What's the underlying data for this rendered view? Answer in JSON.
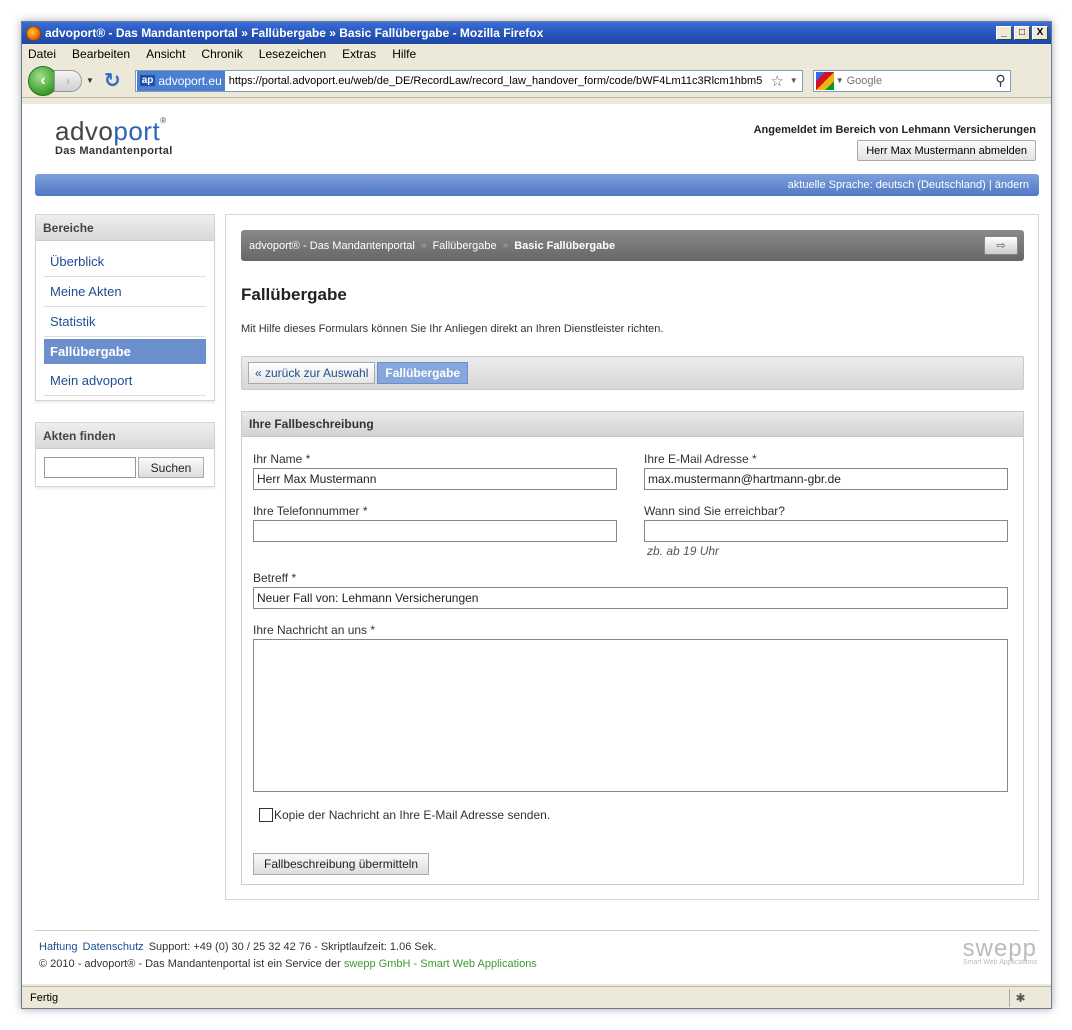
{
  "window": {
    "title": "advoport® - Das Mandantenportal » Fallübergabe » Basic Fallübergabe - Mozilla Firefox",
    "min": "_",
    "max": "□",
    "close": "X"
  },
  "menu": [
    "Datei",
    "Bearbeiten",
    "Ansicht",
    "Chronik",
    "Lesezeichen",
    "Extras",
    "Hilfe"
  ],
  "nav": {
    "site_badge": "ap",
    "site_name": "advoport.eu",
    "url": "https://portal.advoport.eu/web/de_DE/RecordLaw/record_law_handover_form/code/bWF4Lm11c3Rlcm1hbm5",
    "search_placeholder": "Google"
  },
  "header": {
    "logo_a": "advo",
    "logo_b": "port",
    "logo_reg": "®",
    "logo_sub": "Das Mandantenportal",
    "logged_in": "Angemeldet im Bereich von Lehmann Versicherungen",
    "logout": "Herr Max Mustermann abmelden"
  },
  "lang": "aktuelle Sprache: deutsch (Deutschland) | ändern",
  "sidebar": {
    "areas_title": "Bereiche",
    "items": [
      "Überblick",
      "Meine Akten",
      "Statistik",
      "Fallübergabe",
      "Mein advoport"
    ],
    "find_title": "Akten finden",
    "find_button": "Suchen"
  },
  "breadcrumb": {
    "c1": "advoport® - Das Mandantenportal",
    "c2": "Fallübergabe",
    "c3": "Basic Fallübergabe",
    "sep": "»",
    "icon": "⇨"
  },
  "main": {
    "title": "Fallübergabe",
    "intro": "Mit Hilfe dieses Formulars können Sie Ihr Anliegen direkt an Ihren Dienstleister richten.",
    "tab_back": "« zurück zur Auswahl",
    "tab_active": "Fallübergabe"
  },
  "form": {
    "title": "Ihre Fallbeschreibung",
    "name_label": "Ihr Name *",
    "name_value": "Herr Max Mustermann",
    "email_label": "Ihre E-Mail Adresse *",
    "email_value": "max.mustermann@hartmann-gbr.de",
    "phone_label": "Ihre Telefonnummer *",
    "phone_value": "",
    "reach_label": "Wann sind Sie erreichbar?",
    "reach_value": "",
    "reach_hint": "zb. ab 19 Uhr",
    "subject_label": "Betreff *",
    "subject_value": "Neuer Fall von: Lehmann Versicherungen",
    "message_label": "Ihre Nachricht an uns *",
    "copy_label": "Kopie der Nachricht an Ihre E-Mail Adresse senden.",
    "submit": "Fallbeschreibung übermitteln"
  },
  "footer": {
    "haftung": "Haftung",
    "datenschutz": "Datenschutz",
    "support": "Support: +49 (0) 30 / 25 32 42 76 - Skriptlaufzeit: 1.06 Sek.",
    "copy": "© 2010 - advoport® - Das Mandantenportal ist ein Service der",
    "company": "swepp GmbH - Smart Web Applications",
    "logo": "swepp",
    "logo_sub": "Smart Web Applications"
  },
  "status": "Fertig"
}
